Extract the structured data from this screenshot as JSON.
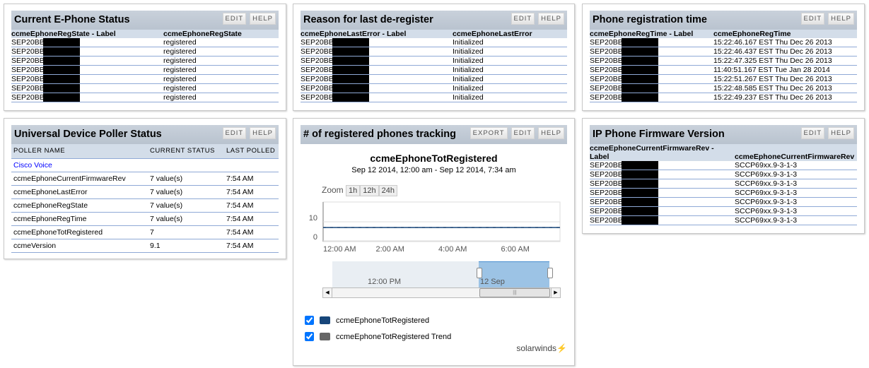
{
  "buttons": {
    "edit": "EDIT",
    "help": "HELP",
    "export": "EXPORT"
  },
  "regstate": {
    "title": "Current E-Phone Status",
    "headers": [
      "ccmeEphoneRegState - Label",
      "ccmeEphoneRegState"
    ],
    "rows": [
      [
        "SEP20BB",
        "registered"
      ],
      [
        "SEP20BB",
        "registered"
      ],
      [
        "SEP20BB",
        "registered"
      ],
      [
        "SEP20BB",
        "registered"
      ],
      [
        "SEP20BB",
        "registered"
      ],
      [
        "SEP20BB",
        "registered"
      ],
      [
        "SEP20BB",
        "registered"
      ]
    ]
  },
  "lasterror": {
    "title": "Reason for last de-register",
    "headers": [
      "ccmeEphoneLastError - Label",
      "ccmeEphoneLastError"
    ],
    "rows": [
      [
        "SEP20BB",
        "Initialized"
      ],
      [
        "SEP20BB",
        "Initialized"
      ],
      [
        "SEP20BB",
        "Initialized"
      ],
      [
        "SEP20BB",
        "Initialized"
      ],
      [
        "SEP20BB",
        "Initialized"
      ],
      [
        "SEP20BB",
        "Initialized"
      ],
      [
        "SEP20BB",
        "Initialized"
      ]
    ]
  },
  "regtime": {
    "title": "Phone registration time",
    "headers": [
      "ccmeEphoneRegTime - Label",
      "ccmeEphoneRegTime"
    ],
    "rows": [
      [
        "SEP20BB",
        "15:22:46.167 EST Thu Dec 26 2013"
      ],
      [
        "SEP20BB",
        "15:22:46.437 EST Thu Dec 26 2013"
      ],
      [
        "SEP20BB",
        "15:22:47.325 EST Thu Dec 26 2013"
      ],
      [
        "SEP20BB",
        "11:40:51.167 EST Tue Jan 28 2014"
      ],
      [
        "SEP20BB",
        "15:22:51.267 EST Thu Dec 26 2013"
      ],
      [
        "SEP20BB",
        "15:22:48.585 EST Thu Dec 26 2013"
      ],
      [
        "SEP20BB",
        "15:22:49.237 EST Thu Dec 26 2013"
      ]
    ]
  },
  "firmware": {
    "title": "IP Phone Firmware Version",
    "headers": [
      "ccmeEphoneCurrentFirmwareRev - Label",
      "ccmeEphoneCurrentFirmwareRev"
    ],
    "rows": [
      [
        "SEP20BB",
        "SCCP69xx.9-3-1-3"
      ],
      [
        "SEP20BB",
        "SCCP69xx.9-3-1-3"
      ],
      [
        "SEP20BB",
        "SCCP69xx.9-3-1-3"
      ],
      [
        "SEP20BB",
        "SCCP69xx.9-3-1-3"
      ],
      [
        "SEP20BB",
        "SCCP69xx.9-3-1-3"
      ],
      [
        "SEP20BB",
        "SCCP69xx.9-3-1-3"
      ],
      [
        "SEP20BB",
        "SCCP69xx.9-3-1-3"
      ]
    ]
  },
  "poller": {
    "title": "Universal Device Poller Status",
    "headers": [
      "POLLER NAME",
      "CURRENT STATUS",
      "LAST POLLED"
    ],
    "group": "Cisco Voice",
    "rows": [
      [
        "ccmeEphoneCurrentFirmwareRev",
        "7 value(s)",
        "7:54 AM"
      ],
      [
        "ccmeEphoneLastError",
        "7 value(s)",
        "7:54 AM"
      ],
      [
        "ccmeEphoneRegState",
        "7 value(s)",
        "7:54 AM"
      ],
      [
        "ccmeEphoneRegTime",
        "7 value(s)",
        "7:54 AM"
      ],
      [
        "ccmeEphoneTotRegistered",
        "7",
        "7:54 AM"
      ],
      [
        "ccmeVersion",
        "9.1",
        "7:54 AM"
      ]
    ]
  },
  "tracking": {
    "title": "# of registered phones tracking",
    "zoom_label": "Zoom",
    "zoom_options": [
      "1h",
      "12h",
      "24h"
    ],
    "navigator_labels": [
      "12:00 PM",
      "12 Sep"
    ],
    "brand": "solarwinds"
  },
  "chart_data": {
    "type": "line",
    "title": "ccmeEphoneTotRegistered",
    "subtitle": "Sep 12 2014, 12:00 am - Sep 12 2014, 7:34 am",
    "x_hours": [
      0,
      1,
      2,
      3,
      4,
      5,
      6,
      7,
      7.57
    ],
    "series": [
      {
        "name": "ccmeEphoneTotRegistered",
        "color": "#17467a",
        "values": [
          7,
          7,
          7,
          7,
          7,
          7,
          7,
          7,
          7
        ]
      },
      {
        "name": "ccmeEphoneTotRegistered Trend",
        "color": "#666666",
        "values": [
          7,
          7,
          7,
          7,
          7,
          7,
          7,
          7,
          7
        ]
      }
    ],
    "yticks": [
      0,
      10
    ],
    "ylim": [
      0,
      20
    ],
    "xticks": [
      "12:00 AM",
      "2:00 AM",
      "4:00 AM",
      "6:00 AM"
    ],
    "xtick_hours": [
      0,
      2,
      4,
      6
    ],
    "xlim": [
      0,
      7.57
    ]
  }
}
